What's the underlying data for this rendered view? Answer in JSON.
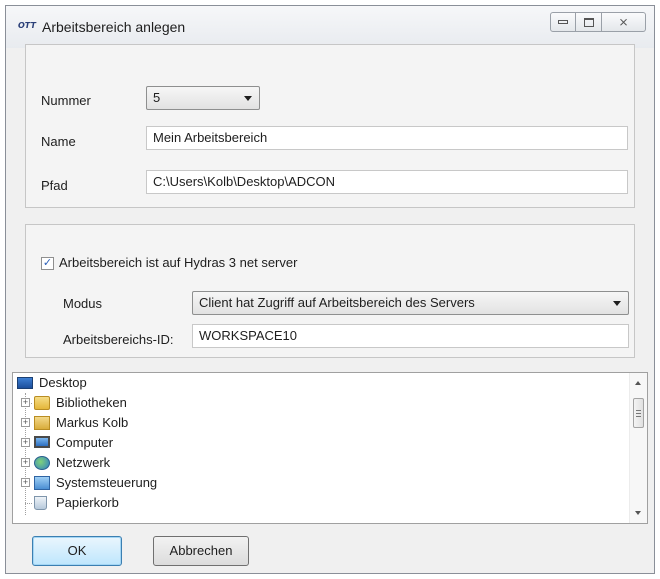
{
  "window": {
    "title": "Arbeitsbereich anlegen",
    "app_icon_text": "OTT",
    "controls": {
      "close_symbol": "⨯"
    }
  },
  "form": {
    "number_label": "Nummer",
    "number_value": "5",
    "name_label": "Name",
    "name_value": "Mein Arbeitsbereich",
    "path_label": "Pfad",
    "path_value": "C:\\Users\\Kolb\\Desktop\\ADCON"
  },
  "server": {
    "checkbox_label": "Arbeitsbereich ist auf Hydras 3 net server",
    "checked": true,
    "check_mark": "✓",
    "mode_label": "Modus",
    "mode_value": "Client hat Zugriff auf Arbeitsbereich des Servers",
    "workspace_id_label": "Arbeitsbereichs-ID:",
    "workspace_id_value": "WORKSPACE10"
  },
  "tree": {
    "root": {
      "label": "Desktop",
      "icon": "desktop-icon"
    },
    "items": [
      {
        "label": "Bibliotheken",
        "icon": "libraries-icon",
        "expander": "+"
      },
      {
        "label": "Markus Kolb",
        "icon": "user-folder-icon",
        "expander": "+"
      },
      {
        "label": "Computer",
        "icon": "computer-icon",
        "expander": "+"
      },
      {
        "label": "Netzwerk",
        "icon": "network-icon",
        "expander": "+"
      },
      {
        "label": "Systemsteuerung",
        "icon": "control-panel-icon",
        "expander": "+"
      },
      {
        "label": "Papierkorb",
        "icon": "recycle-bin-icon",
        "expander": ""
      }
    ]
  },
  "buttons": {
    "ok": "OK",
    "cancel": "Abbrechen"
  },
  "colors": {
    "accent": "#3c7fb1",
    "checkmark": "#2b5fb8",
    "window_bg": "#f0f0f0"
  }
}
